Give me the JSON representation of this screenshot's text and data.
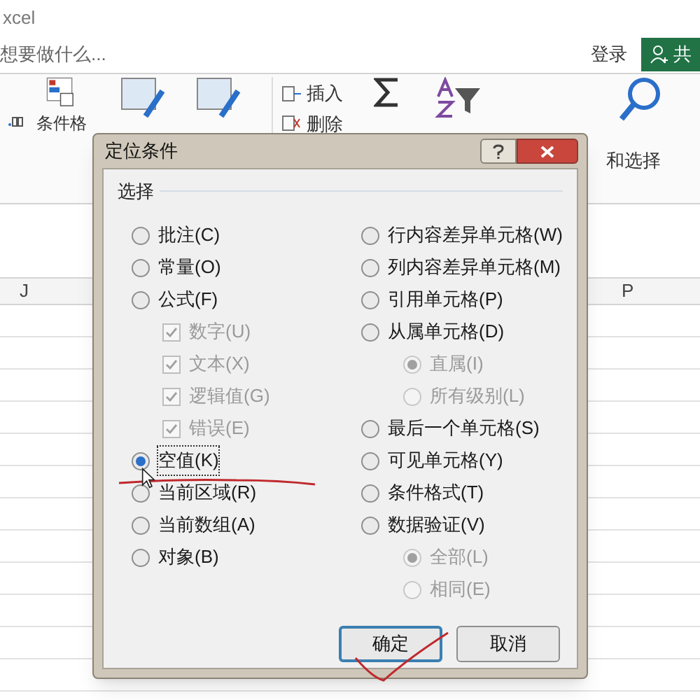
{
  "window": {
    "title": "xcel"
  },
  "tell_me": {
    "placeholder": "想要做什么..."
  },
  "sign_in": "登录",
  "share": "共",
  "ribbon": {
    "format_label": "条件格",
    "insert": "插入",
    "delete": "删除",
    "find_select": "和选择"
  },
  "columns": [
    "J",
    "P"
  ],
  "dialog": {
    "title": "定位条件",
    "group_label": "选择",
    "left": [
      {
        "kind": "radio",
        "label": "批注(C)",
        "selected": false,
        "disabled": false
      },
      {
        "kind": "radio",
        "label": "常量(O)",
        "selected": false,
        "disabled": false
      },
      {
        "kind": "radio",
        "label": "公式(F)",
        "selected": false,
        "disabled": false
      },
      {
        "kind": "checkbox",
        "label": "数字(U)",
        "checked": true,
        "disabled": true
      },
      {
        "kind": "checkbox",
        "label": "文本(X)",
        "checked": true,
        "disabled": true
      },
      {
        "kind": "checkbox",
        "label": "逻辑值(G)",
        "checked": true,
        "disabled": true
      },
      {
        "kind": "checkbox",
        "label": "错误(E)",
        "checked": true,
        "disabled": true
      },
      {
        "kind": "radio",
        "label": "空值(K)",
        "selected": true,
        "disabled": false
      },
      {
        "kind": "radio",
        "label": "当前区域(R)",
        "selected": false,
        "disabled": false
      },
      {
        "kind": "radio",
        "label": "当前数组(A)",
        "selected": false,
        "disabled": false
      },
      {
        "kind": "radio",
        "label": "对象(B)",
        "selected": false,
        "disabled": false
      }
    ],
    "right": [
      {
        "kind": "radio",
        "label": "行内容差异单元格(W)",
        "selected": false,
        "disabled": false
      },
      {
        "kind": "radio",
        "label": "列内容差异单元格(M)",
        "selected": false,
        "disabled": false
      },
      {
        "kind": "radio",
        "label": "引用单元格(P)",
        "selected": false,
        "disabled": false
      },
      {
        "kind": "radio",
        "label": "从属单元格(D)",
        "selected": false,
        "disabled": false
      },
      {
        "kind": "subradio",
        "label": "直属(I)",
        "selected": true,
        "disabled": true
      },
      {
        "kind": "subradio",
        "label": "所有级别(L)",
        "selected": false,
        "disabled": true
      },
      {
        "kind": "radio",
        "label": "最后一个单元格(S)",
        "selected": false,
        "disabled": false
      },
      {
        "kind": "radio",
        "label": "可见单元格(Y)",
        "selected": false,
        "disabled": false
      },
      {
        "kind": "radio",
        "label": "条件格式(T)",
        "selected": false,
        "disabled": false
      },
      {
        "kind": "radio",
        "label": "数据验证(V)",
        "selected": false,
        "disabled": false
      },
      {
        "kind": "subradio",
        "label": "全部(L)",
        "selected": true,
        "disabled": true
      },
      {
        "kind": "subradio",
        "label": "相同(E)",
        "selected": false,
        "disabled": true
      }
    ],
    "buttons": [
      {
        "label": "确定",
        "default": true
      },
      {
        "label": "取消",
        "default": false
      }
    ]
  }
}
